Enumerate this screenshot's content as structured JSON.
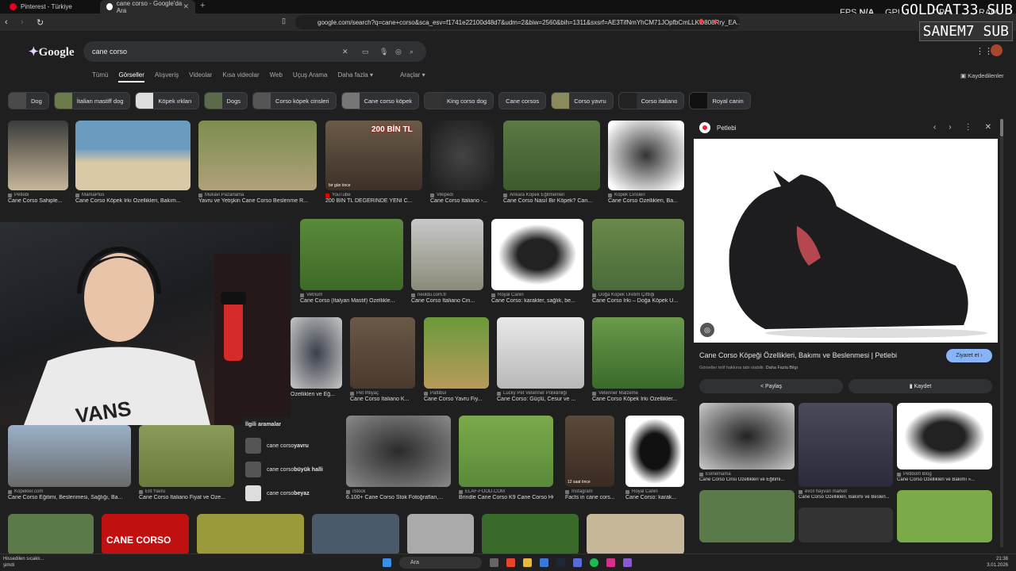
{
  "browser": {
    "tabs": [
      {
        "label": "Pinterest - Türkiye",
        "active": false
      },
      {
        "label": "cane corso - Google'da Ara",
        "active": true
      }
    ],
    "url": "google.com/search?q=cane+corso&sca_esv=f1741e22100d48d7&udm=2&biw=2560&bih=1311&sxsrf=AE3TifNmYhCM71JOpfbCmLLKO808Rry_EA..."
  },
  "overlay": {
    "fps_label": "FPS",
    "fps_value": "N/A",
    "gpu_label": "GPU",
    "cpu_label": "CPU",
    "ram_label": "RAM",
    "donor1": "GOLDCAT33 SUB",
    "donor2": "SANEM7 SUB"
  },
  "google": {
    "logo": "Google",
    "query": "cane corso",
    "tabs": [
      "Tümü",
      "Görseller",
      "Alışveriş",
      "Videolar",
      "Kısa videolar",
      "Web",
      "Uçuş Arama",
      "Daha fazla ▾"
    ],
    "active_tab": "Görseller",
    "tools": "Araçlar ▾",
    "saved": "Kaydedilenler",
    "chips": [
      "Dog",
      "İtalian mastiff dog",
      "Köpek ırkları",
      "Dogs",
      "Corso köpek cinsleri",
      "Cane corso köpek",
      "King corso dog",
      "Cane corsos",
      "Corso yavru",
      "Corso italiano",
      "Royal canin"
    ]
  },
  "results": {
    "row1": [
      {
        "source": "Petlebi",
        "caption": "Cane Corso Sahiple..."
      },
      {
        "source": "MamaPlus",
        "caption": "Cane Corso Köpek Irkı Özellikleri, Bakım..."
      },
      {
        "source": "Mukavi Pazarlama",
        "caption": "Yavru ve Yetişkin Cane Corso Beslenme R..."
      },
      {
        "source": "YouTube",
        "caption": "200 BİN TL DEĞERİNDE YENİ C...",
        "badge": "200 BİN TL",
        "note": "bir gün önce"
      },
      {
        "source": "Vikipedi",
        "caption": "Cane Corso Italiano -..."
      },
      {
        "source": "Ankara Köpek Eğitmenleri",
        "caption": "Cane Corso Nasıl Bir Köpek? Can..."
      },
      {
        "source": "Köpek Cinsleri",
        "caption": "Cane Corso Özellikleri, Ba..."
      }
    ],
    "row2": [
      {
        "source": "Vetrium",
        "caption": "Cane Corso (İtalyan Mastif) Özellikle..."
      },
      {
        "source": "neoldu.com.tr",
        "caption": "Cane Corso İtaliano Cin..."
      },
      {
        "source": "Royal Canin",
        "caption": "Cane Corso: karakter, sağlık, be..."
      },
      {
        "source": "Doğa Köpek Üretim Çiftliği",
        "caption": "Cane Corso Irkı – Doğa Köpek Ü..."
      }
    ],
    "row3": [
      {
        "source": "",
        "caption": "Özellikleri ve Eğ..."
      },
      {
        "source": "Pet İhtiyaç",
        "caption": "Cane Corso İtaliano K..."
      },
      {
        "source": "Pattibul",
        "caption": "Cane Corso Yavru Fiy..."
      },
      {
        "source": "Lucky Pet Veteriner Poliklinliği",
        "caption": "Cane Corso: Güçlü, Cesur ve ..."
      },
      {
        "source": "Veteriner Malzeme",
        "caption": "Cane Corso Köpek Irkı Özellikler..."
      }
    ],
    "row4": [
      {
        "source": "Kopekler.com",
        "caption": "Cane Corso Eğitimi, Beslenmesi, Sağlığı, Ba..."
      },
      {
        "source": "Elit Yavru",
        "caption": "Cane Corso İtaliano Fiyat ve Öze..."
      },
      {
        "source": "iStock",
        "caption": "6.100+ Cane Corso Stok Fotoğrafları,..."
      },
      {
        "source": "ELAF-FOOD.COM",
        "caption": "Brindle Cane Corso K9 Cane Corso HO..."
      },
      {
        "source": "Instagram",
        "caption": "Facts in cane cors...",
        "note": "12 saat önce"
      },
      {
        "source": "Royal Canin",
        "caption": "Cane Corso: karak..."
      }
    ],
    "row5_label": "CANE CORSO"
  },
  "related": {
    "title": "İlgili aramalar",
    "items": [
      {
        "prefix": "cane corso ",
        "bold": "yavru"
      },
      {
        "prefix": "cane corso ",
        "bold": "büyük halli"
      },
      {
        "prefix": "cane corso ",
        "bold": "beyaz"
      }
    ]
  },
  "panel": {
    "site": "Petlebi",
    "title": "Cane Corso Köpeği Özellikleri, Bakımı ve Beslenmesi | Petlebi",
    "visit": "Ziyaret et",
    "rights": "Görseller telif hakkına tabi olabilir.",
    "more_info": "Daha Fazla Bilgi",
    "share": "Paylaş",
    "save": "Kaydet",
    "similar": [
      {
        "source": "Evinemama",
        "caption": "Cane Corso Cinsi Özellikleri ve Eğitimi..."
      },
      {
        "source": "evcil hayvan market",
        "caption": "Cane Corso Özellikleri, Bakımı ve Beslen..."
      },
      {
        "source": "Petibom Blog",
        "caption": "Cane Corso Özellikleri ve Bakımı »..."
      }
    ]
  },
  "taskbar": {
    "weather1": "Hissedilen sıcaklı...",
    "weather2": "şimdi",
    "search": "Ara",
    "time": "21:38",
    "date": "3.01.2026"
  }
}
